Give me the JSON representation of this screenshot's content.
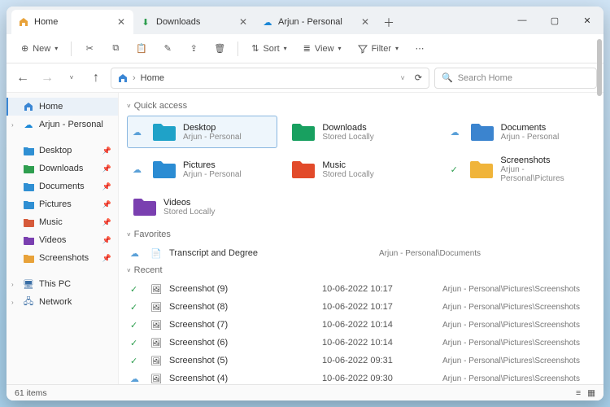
{
  "tabs": [
    {
      "label": "Home",
      "icon": "home",
      "active": true
    },
    {
      "label": "Downloads",
      "icon": "download",
      "active": false
    },
    {
      "label": "Arjun - Personal",
      "icon": "cloud",
      "active": false
    }
  ],
  "toolbar": {
    "new_label": "New",
    "sort_label": "Sort",
    "view_label": "View",
    "filter_label": "Filter"
  },
  "address": {
    "crumb": "Home"
  },
  "search": {
    "placeholder": "Search Home"
  },
  "sidebar": {
    "home": "Home",
    "personal": "Arjun - Personal",
    "pinned": [
      {
        "label": "Desktop",
        "color": "#2f8fd3"
      },
      {
        "label": "Downloads",
        "color": "#2e9e4f"
      },
      {
        "label": "Documents",
        "color": "#2f8fd3"
      },
      {
        "label": "Pictures",
        "color": "#2f8fd3"
      },
      {
        "label": "Music",
        "color": "#d65a3a"
      },
      {
        "label": "Videos",
        "color": "#7a3fb0"
      },
      {
        "label": "Screenshots",
        "color": "#e8a23a"
      }
    ],
    "thispc": "This PC",
    "network": "Network"
  },
  "sections": {
    "quick": "Quick access",
    "favorites": "Favorites",
    "recent": "Recent"
  },
  "quick_access": [
    {
      "name": "Desktop",
      "sub": "Arjun - Personal",
      "color": "#1fa2c8",
      "status": "cloud",
      "selected": true
    },
    {
      "name": "Downloads",
      "sub": "Stored Locally",
      "color": "#18a060",
      "status": ""
    },
    {
      "name": "Documents",
      "sub": "Arjun - Personal",
      "color": "#3b84cf",
      "status": "cloud"
    },
    {
      "name": "Pictures",
      "sub": "Arjun - Personal",
      "color": "#2b8cd3",
      "status": "cloud"
    },
    {
      "name": "Music",
      "sub": "Stored Locally",
      "color": "#e24a2a",
      "status": ""
    },
    {
      "name": "Screenshots",
      "sub": "Arjun - Personal\\Pictures",
      "color": "#f0b43a",
      "status": "sync"
    },
    {
      "name": "Videos",
      "sub": "Stored Locally",
      "color": "#7a3fb0",
      "status": ""
    }
  ],
  "favorites": [
    {
      "name": "Transcript and Degree",
      "path": "Arjun - Personal\\Documents",
      "status": "cloud"
    }
  ],
  "recent": [
    {
      "name": "Screenshot (9)",
      "date": "10-06-2022 10:17",
      "path": "Arjun - Personal\\Pictures\\Screenshots",
      "status": "sync"
    },
    {
      "name": "Screenshot (8)",
      "date": "10-06-2022 10:17",
      "path": "Arjun - Personal\\Pictures\\Screenshots",
      "status": "sync"
    },
    {
      "name": "Screenshot (7)",
      "date": "10-06-2022 10:14",
      "path": "Arjun - Personal\\Pictures\\Screenshots",
      "status": "sync"
    },
    {
      "name": "Screenshot (6)",
      "date": "10-06-2022 10:14",
      "path": "Arjun - Personal\\Pictures\\Screenshots",
      "status": "sync"
    },
    {
      "name": "Screenshot (5)",
      "date": "10-06-2022 09:31",
      "path": "Arjun - Personal\\Pictures\\Screenshots",
      "status": "sync"
    },
    {
      "name": "Screenshot (4)",
      "date": "10-06-2022 09:30",
      "path": "Arjun - Personal\\Pictures\\Screenshots",
      "status": "cloud"
    }
  ],
  "status": {
    "items": "61 items"
  }
}
